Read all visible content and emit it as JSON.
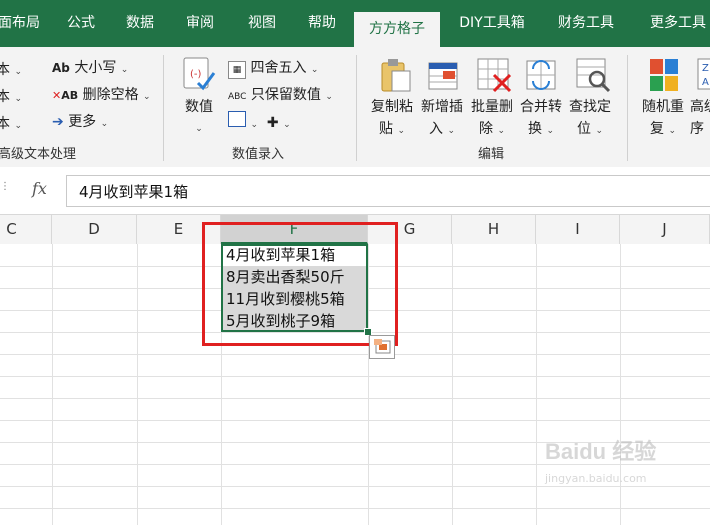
{
  "tabs": [
    "页面布局",
    "公式",
    "数据",
    "审阅",
    "视图",
    "帮助",
    "方方格子",
    "DIY工具箱",
    "财务工具",
    "更多工具"
  ],
  "tab_first_partial": "面布局",
  "ribbon": {
    "text_group": {
      "partial_rows": [
        "本",
        "本",
        "本"
      ],
      "case_label": "大小写",
      "delete_space_label": "删除空格",
      "more_label": "更多",
      "group_label": "高级文本处理"
    },
    "number_group": {
      "value_button": "数值",
      "round_label": "四舍五入",
      "keep_value_label": "只保留数值",
      "group_label": "数值录入"
    },
    "edit_group": {
      "buttons": [
        {
          "line1": "复制粘",
          "line2": "贴"
        },
        {
          "line1": "新增插",
          "line2": "入"
        },
        {
          "line1": "批量删",
          "line2": "除"
        },
        {
          "line1": "合并转",
          "line2": "换"
        },
        {
          "line1": "查找定",
          "line2": "位"
        }
      ],
      "group_label": "编辑"
    },
    "extra_group": {
      "buttons": [
        {
          "line1": "随机重",
          "line2": "复"
        },
        {
          "line1": "高级",
          "line2": "序"
        }
      ]
    }
  },
  "formula_bar": {
    "fx_label": "fx",
    "content": "4月收到苹果1箱"
  },
  "columns": [
    "C",
    "D",
    "E",
    "F",
    "G",
    "H",
    "I",
    "J"
  ],
  "selected_column": "F",
  "cells": [
    "4月收到苹果1箱",
    "8月卖出香梨50斤",
    "11月收到樱桃5箱",
    "5月收到桃子9箱"
  ],
  "watermark": "Baidu 经验",
  "watermark_url": "jingyan.baidu.com",
  "colors": {
    "accent": "#217346",
    "highlight": "#e02020"
  }
}
